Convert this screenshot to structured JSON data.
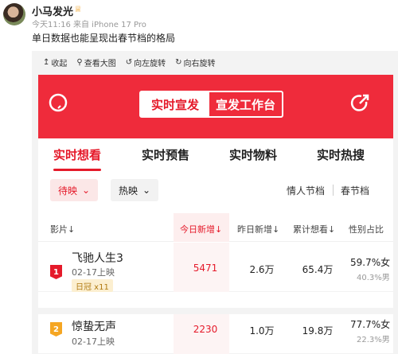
{
  "post": {
    "username": "小马发光",
    "vip_icon": "crown-icon",
    "meta": "今天11:16 来自 iPhone 17 Pro",
    "caption": "单日数据也能呈现出春节档的格局"
  },
  "toolbar": {
    "collapse": "收起",
    "view_large": "查看大图",
    "rotate_left": "向左旋转",
    "rotate_right": "向右旋转"
  },
  "app": {
    "segment_active": "实时宣发",
    "segment_other": "宣发工作台",
    "tabs": [
      "实时想看",
      "实时预售",
      "实时物料",
      "实时热搜"
    ],
    "filter_status": "待映",
    "filter_hot": "热映",
    "link_valentine": "情人节档",
    "link_spring": "春节档",
    "columns": {
      "film": "影片↓",
      "today": "今日新增↓",
      "yesterday": "昨日新增↓",
      "total": "累计想看↓",
      "gender": "性别占比"
    },
    "rows": [
      {
        "rank": "1",
        "title": "飞驰人生3",
        "date": "02-17上映",
        "badge": "日冠 x11",
        "today": "5471",
        "yesterday": "2.6万",
        "total": "65.4万",
        "female": "59.7%女",
        "male": "40.3%男"
      },
      {
        "rank": "2",
        "title": "惊蛰无声",
        "date": "02-17上映",
        "today": "2230",
        "yesterday": "1.0万",
        "total": "19.8万",
        "female": "77.7%女",
        "male": "22.3%男"
      }
    ],
    "colors": {
      "brand_red": "#ef2b3b",
      "rank1": "#e51a2a",
      "rank2": "#f5a623"
    }
  }
}
